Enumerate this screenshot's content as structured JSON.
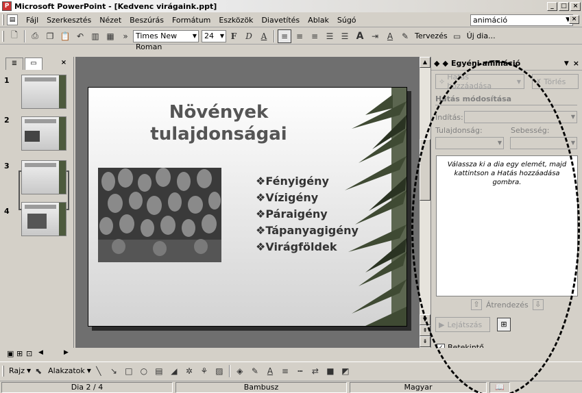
{
  "window": {
    "title": "Microsoft PowerPoint - [Kedvenc virágaink.ppt]",
    "minimize": "_",
    "maximize": "□",
    "close": "×"
  },
  "menu": {
    "items": [
      "Fájl",
      "Szerkesztés",
      "Nézet",
      "Beszúrás",
      "Formátum",
      "Eszközök",
      "Diavetítés",
      "Ablak",
      "Súgó"
    ],
    "help_query": "animáció"
  },
  "toolbar": {
    "font_name": "Times New Roman",
    "font_size": "24",
    "bold": "F",
    "italic": "D",
    "underline": "A",
    "design_label": "Tervezés",
    "new_slide_label": "Új dia..."
  },
  "left_panel": {
    "slides": [
      "1",
      "2",
      "3",
      "4"
    ]
  },
  "slide": {
    "title_line1": "Növények",
    "title_line2": "tulajdonságai",
    "bullets": [
      "Fényigény",
      "Vízigény",
      "Páraigény",
      "Tápanyagigény",
      "Virágföldek"
    ]
  },
  "task_pane": {
    "title": "Egyéni animáció",
    "add_effect": "Hatás hozzáadása",
    "remove": "Törlés",
    "modify_header": "Hatás módosítása",
    "start_label": "Indítás:",
    "property_label": "Tulajdonság:",
    "speed_label": "Sebesség:",
    "hint_text": "Válassza ki a dia egy elemét, majd kattintson a Hatás hozzáadása gombra.",
    "reorder_label": "Átrendezés",
    "play_label": "Lejátszás",
    "preview_label": "Betekintő"
  },
  "drawing": {
    "draw_label": "Rajz",
    "autoshapes_label": "Alakzatok"
  },
  "status": {
    "slide_info": "Dia 2 / 4",
    "design_name": "Bambusz",
    "language": "Magyar"
  }
}
